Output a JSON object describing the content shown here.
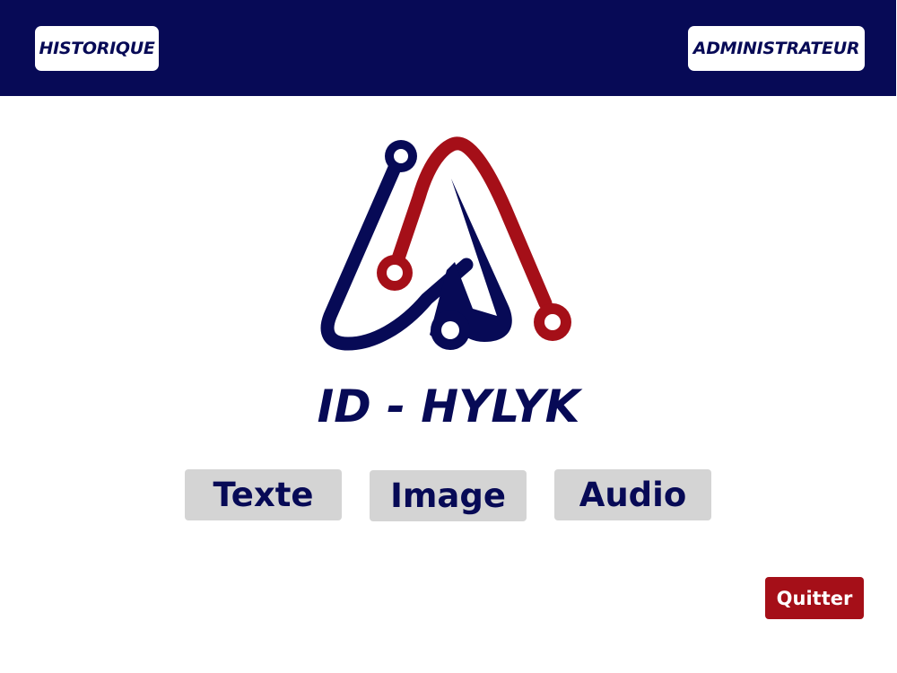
{
  "header": {
    "history_label": "HISTORIQUE",
    "admin_label": "ADMINISTRATEUR"
  },
  "main": {
    "app_title": "ID - HYLYK",
    "logo_icon": "circuit-letter-a-logo",
    "modes": [
      {
        "label": "Texte"
      },
      {
        "label": "Image"
      },
      {
        "label": "Audio"
      }
    ]
  },
  "footer": {
    "quit_label": "Quitter"
  },
  "colors": {
    "primary": "#070a56",
    "accent": "#a50f18",
    "button_gray": "#d4d4d4",
    "background": "#ffffff"
  }
}
